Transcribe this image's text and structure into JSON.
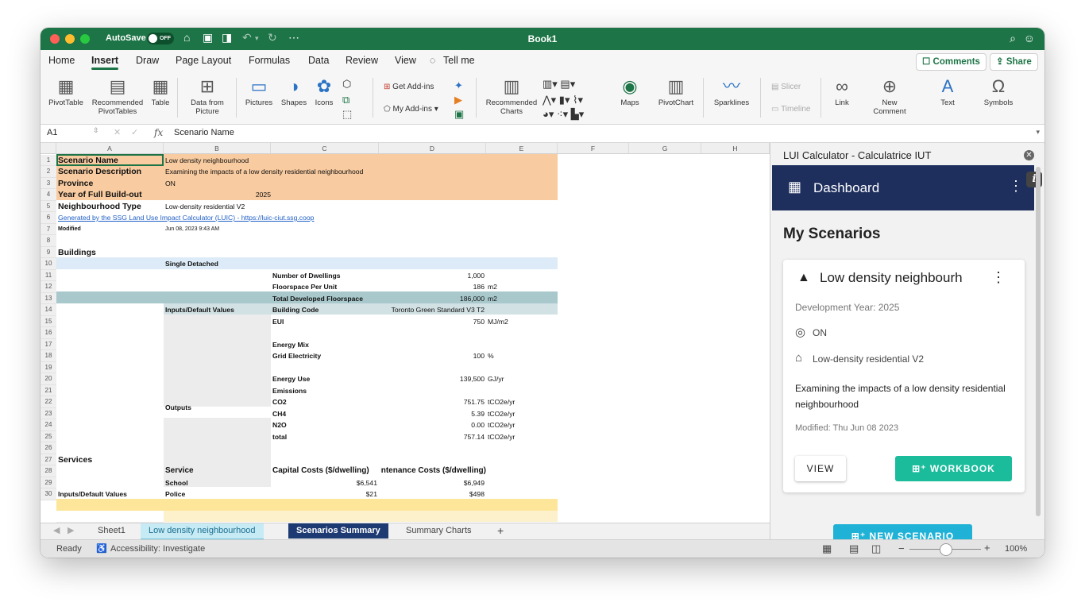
{
  "window": {
    "autosave_label": "AutoSave",
    "autosave_state": "OFF",
    "doc_title": "Book1"
  },
  "ribbon_tabs": [
    "Home",
    "Insert",
    "Draw",
    "Page Layout",
    "Formulas",
    "Data",
    "Review",
    "View",
    "Tell me"
  ],
  "active_tab": "Insert",
  "header_buttons": {
    "comments": "Comments",
    "share": "Share"
  },
  "ribbon": {
    "pivottable": "PivotTable",
    "recommended_pivot": "Recommended PivotTables",
    "table": "Table",
    "data_from_picture": "Data from Picture",
    "pictures": "Pictures",
    "shapes": "Shapes",
    "icons": "Icons",
    "get_addins": "Get Add-ins",
    "my_addins": "My Add-ins",
    "recommended_charts": "Recommended Charts",
    "maps": "Maps",
    "pivotchart": "PivotChart",
    "sparklines": "Sparklines",
    "slicer": "Slicer",
    "timeline": "Timeline",
    "link": "Link",
    "new_comment": "New Comment",
    "text": "Text",
    "symbols": "Symbols"
  },
  "formula_bar": {
    "cell_ref": "A1",
    "content": "Scenario Name"
  },
  "columns": [
    "A",
    "B",
    "C",
    "D",
    "E",
    "F",
    "G",
    "H"
  ],
  "rows": [
    "1",
    "2",
    "3",
    "4",
    "5",
    "6",
    "7",
    "8",
    "9",
    "10",
    "11",
    "12",
    "13",
    "14",
    "15",
    "16",
    "17",
    "18",
    "19",
    "20",
    "21",
    "22",
    "23",
    "24",
    "25",
    "26",
    "27",
    "28",
    "29",
    "30"
  ],
  "sheet": {
    "scenario_name_label": "Scenario Name",
    "scenario_name": "Low density neighbourhood",
    "scenario_desc_label": "Scenario Description",
    "scenario_desc": "Examining the impacts of a low density residential neighbourhood",
    "province_label": "Province",
    "province": "ON",
    "year_label": "Year of Full Build-out",
    "year": "2025",
    "ntype_label": "Neighbourhood Type",
    "ntype": "Low-density residential V2",
    "generated": "Generated by the SSG Land Use Impact Calculator (LUIC) - https://luic-ciut.ssg.coop",
    "modified_label": "Modified",
    "modified": "Jun 08, 2023 9:43 AM",
    "buildings": "Buildings",
    "single_detached": "Single Detached",
    "inputs_defaults": "Inputs/Default Values",
    "outputs": "Outputs",
    "num_dwellings_label": "Number of Dwellings",
    "num_dwellings": "1,000",
    "floor_per_unit_label": "Floorspace Per Unit",
    "floor_per_unit": "186",
    "floor_unit": "m2",
    "total_floor_label": "Total Developed Floorspace",
    "total_floor": "186,000",
    "total_floor_unit": "m2",
    "building_code_label": "Building Code",
    "building_code": "Toronto Green Standard V3 T2",
    "eui_label": "EUI",
    "eui": "750",
    "eui_unit": "MJ/m2",
    "energy_mix": "Energy Mix",
    "grid_elec_label": "Grid Electricity",
    "grid_elec": "100",
    "grid_elec_unit": "%",
    "energy_use_label": "Energy Use",
    "energy_use": "139,500",
    "energy_use_unit": "GJ/yr",
    "emissions": "Emissions",
    "co2_label": "CO2",
    "co2": "751.75",
    "co2_unit": "tCO2e/yr",
    "ch4_label": "CH4",
    "ch4": "5.39",
    "ch4_unit": "tCO2e/yr",
    "n2o_label": "N2O",
    "n2o": "0.00",
    "n2o_unit": "tCO2e/yr",
    "total_label": "total",
    "total": "757.14",
    "total_unit": "tCO2e/yr",
    "services": "Services",
    "service_hdr": "Service",
    "capital_hdr": "Capital Costs ($/dwelling)",
    "maint_hdr": "Maintenance Costs ($/dwelling)",
    "school": "School",
    "school_cap": "$6,541",
    "school_maint": "$6,949",
    "police": "Police",
    "police_cap": "$21",
    "police_maint": "$498",
    "inputs_defaults_2": "Inputs/Default Values"
  },
  "sheet_tabs": [
    "Sheet1",
    "Low density neighbourhood",
    "Scenarios Summary",
    "Summary Charts"
  ],
  "status": {
    "ready": "Ready",
    "accessibility": "Accessibility: Investigate",
    "zoom": "100%"
  },
  "pane": {
    "title": "LUI Calculator - Calculatrice IUT",
    "appbar_title": "Dashboard",
    "heading": "My Scenarios",
    "card": {
      "name": "Low density neighbourh",
      "dev_year": "Development Year: 2025",
      "province": "ON",
      "ntype": "Low-density residential V2",
      "description": "Examining the impacts of a low density residential neighbourhood",
      "modified": "Modified: Thu Jun 08 2023",
      "view_btn": "VIEW",
      "workbook_btn": "WORKBOOK"
    },
    "new_scenario_btn": "NEW SCENARIO"
  },
  "colors": {
    "excel_green": "#1d7446",
    "header_orange": "#f8cba0",
    "buildings_teal": "#a8c8cc",
    "light_blue": "#dcebf7",
    "services_yellow": "#fde69a",
    "appbar_navy": "#1e2f5e",
    "teal_btn": "#1abc9c"
  }
}
